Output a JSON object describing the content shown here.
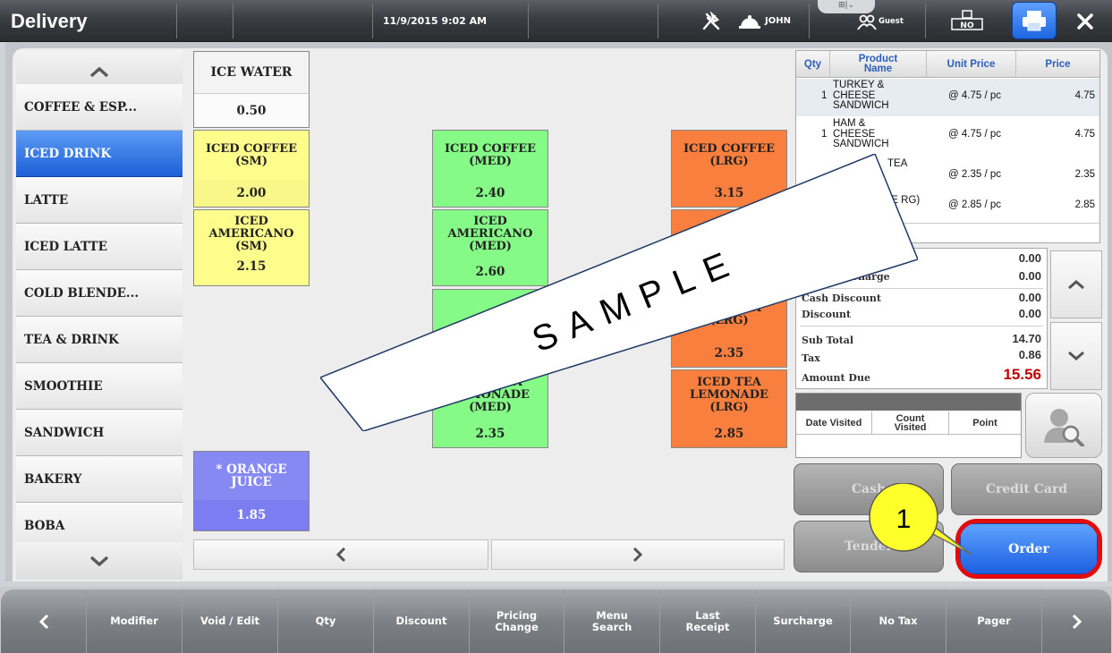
{
  "app": {
    "title": "Delivery",
    "datetime": "11/9/2015  9:02 AM",
    "user": "JOHN",
    "guest_label": "Guest",
    "icons": [
      "utensils-icon",
      "bell-icon",
      "guest-icon",
      "no-tax-icon",
      "print-icon",
      "close-icon"
    ]
  },
  "categories": {
    "items": [
      {
        "label": "COFFEE & ESP..."
      },
      {
        "label": "ICED DRINK",
        "active": true
      },
      {
        "label": "LATTE"
      },
      {
        "label": "ICED LATTE"
      },
      {
        "label": "COLD BLENDE..."
      },
      {
        "label": "TEA & DRINK"
      },
      {
        "label": "SMOOTHIE"
      },
      {
        "label": "SANDWICH"
      },
      {
        "label": "BAKERY"
      },
      {
        "label": "BOBA"
      }
    ]
  },
  "products": {
    "ice_water": {
      "name": "ICE WATER",
      "price": "0.50"
    },
    "iced_coffee_sm": {
      "name": "ICED COFFEE (SM)",
      "price": "2.00"
    },
    "iced_coffee_med": {
      "name": "ICED COFFEE (MED)",
      "price": "2.40"
    },
    "iced_coffee_lrg": {
      "name": "ICED COFFEE (LRG)",
      "price": "3.15"
    },
    "iced_americano_sm": {
      "name": "ICED AMERICANO (SM)",
      "price": "2.15"
    },
    "iced_americano_med": {
      "name": "ICED AMERICANO (MED)",
      "price": "2.60"
    },
    "iced_tea_lrg": {
      "name": "ICED TEA (LRG)",
      "price": "2.35"
    },
    "iced_tea_lemonade_med": {
      "name": "ICED TEA LEMONADE (MED)",
      "price": "2.35"
    },
    "iced_tea_lemonade_lrg": {
      "name": "ICED TEA LEMONADE (LRG)",
      "price": "2.85"
    },
    "orange_juice": {
      "name": "* ORANGE JUICE",
      "price": "1.85"
    }
  },
  "order": {
    "headers": {
      "qty": "Qty",
      "name": "Product Name",
      "unit_price": "Unit Price",
      "price": "Price"
    },
    "rows": [
      {
        "qty": "1",
        "name": "TURKEY & CHEESE SANDWICH",
        "unit_price": "@ 4.75 / pc",
        "price": "4.75"
      },
      {
        "qty": "1",
        "name": "HAM & CHEESE SANDWICH",
        "unit_price": "@ 4.75 / pc",
        "price": "4.75"
      },
      {
        "qty": "",
        "name": "TEA",
        "unit_price": "@ 2.35 / pc",
        "price": "2.35"
      },
      {
        "qty": "",
        "name": "NADE RG)",
        "unit_price": "@ 2.85 / pc",
        "price": "2.85"
      }
    ]
  },
  "totals": {
    "surcharge_label": "Surcharge",
    "surcharge": "0.00",
    "delivery_label": "Delivery Charge",
    "delivery": "0.00",
    "cash_discount_label": "Cash Discount",
    "cash_discount": "0.00",
    "discount_label": "Discount",
    "discount": "0.00",
    "subtotal_label": "Sub Total",
    "subtotal": "14.70",
    "tax_label": "Tax",
    "tax": "0.86",
    "amount_due_label": "Amount Due",
    "amount_due": "15.56",
    "amount_due_color": "#c00000"
  },
  "customer": {
    "date_visited": "Date Visited",
    "count_visited": "Count Visited",
    "point": "Point"
  },
  "payment": {
    "cash": "Cash",
    "credit_card": "Credit Card",
    "tender": "Tender",
    "order": "Order"
  },
  "function_keys": {
    "modifier": "Modifier",
    "void_edit": "Void / Edit",
    "qty": "Qty",
    "discount": "Discount",
    "pricing_change": "Pricing Change",
    "menu_search": "Menu Search",
    "last_receipt": "Last Receipt",
    "surcharge": "Surcharge",
    "no_tax": "No Tax",
    "pager": "Pager"
  },
  "overlays": {
    "watermark_text": "SAMPLE",
    "callout_number": "1",
    "highlight_color": "#e30c0c",
    "callout_color": "#ffff00"
  },
  "colors": {
    "accent_blue": "#1d5fd6",
    "yellow_item": "#fdfd8c",
    "green_item": "#86fa86",
    "orange_item": "#f97f3f",
    "purple_item": "#8789f3"
  }
}
